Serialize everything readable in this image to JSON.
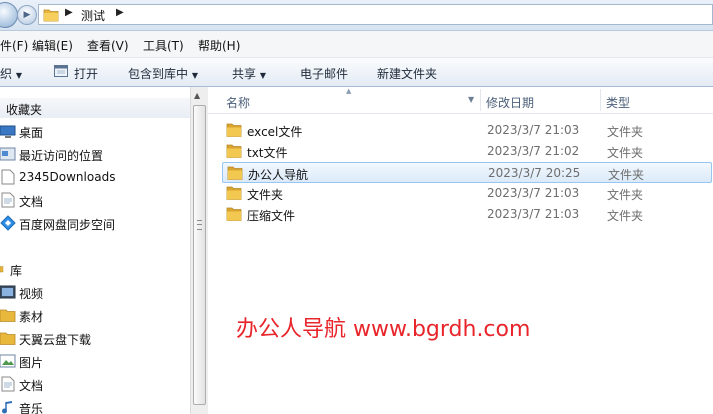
{
  "address": {
    "breadcrumb": "测试"
  },
  "menubar": {
    "items": [
      "件(F)",
      "编辑(E)",
      "查看(V)",
      "工具(T)",
      "帮助(H)"
    ]
  },
  "toolbar": {
    "organize": "织",
    "open": "打开",
    "include_in_library": "包含到库中",
    "share": "共享",
    "email": "电子邮件",
    "new_folder": "新建文件夹"
  },
  "navpane": {
    "favorites": {
      "header": "收藏夹",
      "items": [
        "桌面",
        "最近访问的位置",
        "2345Downloads",
        "文档",
        "百度网盘同步空间"
      ]
    },
    "libraries": {
      "header": "库",
      "items": [
        "视频",
        "素材",
        "天翼云盘下载",
        "图片",
        "文档",
        "音乐"
      ]
    }
  },
  "columns": {
    "name": "名称",
    "date": "修改日期",
    "type": "类型"
  },
  "files": [
    {
      "name": "excel文件",
      "date": "2023/3/7 21:03",
      "type": "文件夹"
    },
    {
      "name": "txt文件",
      "date": "2023/3/7 21:02",
      "type": "文件夹"
    },
    {
      "name": "办公人导航",
      "date": "2023/3/7 20:25",
      "type": "文件夹",
      "selected": true
    },
    {
      "name": "文件夹",
      "date": "2023/3/7 21:03",
      "type": "文件夹"
    },
    {
      "name": "压缩文件",
      "date": "2023/3/7 21:03",
      "type": "文件夹"
    }
  ],
  "watermark": "办公人导航 www.bgrdh.com",
  "icons": [
    "folder-icon",
    "desktop-icon",
    "recent-places-icon",
    "document-icon",
    "sync-icon",
    "library-icon",
    "video-icon",
    "picture-icon",
    "music-icon"
  ],
  "colors": {
    "accent": "#99c6f0",
    "watermark": "#e8252b",
    "folder": "#e8b83c"
  }
}
